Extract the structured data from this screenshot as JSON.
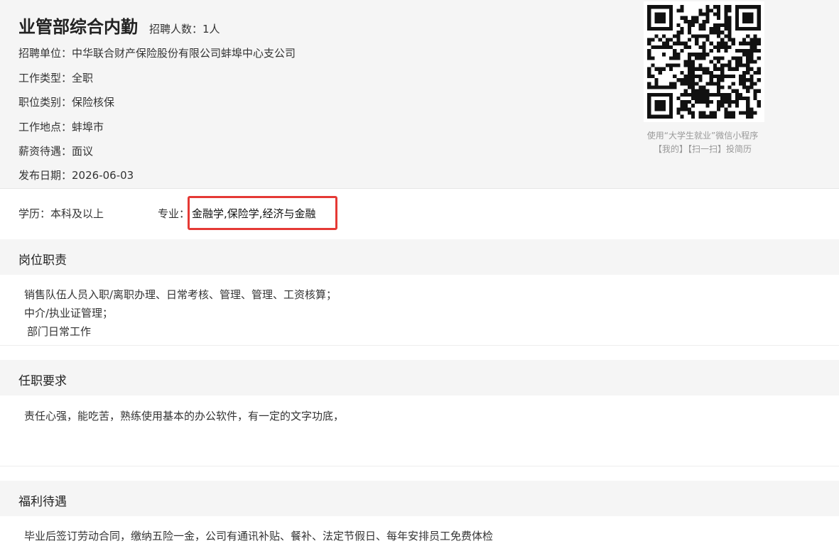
{
  "job": {
    "title": "业管部综合内勤",
    "headcount": "招聘人数：1人",
    "info": [
      {
        "label": "招聘单位：",
        "value": "中华联合财产保险股份有限公司蚌埠中心支公司"
      },
      {
        "label": "工作类型：",
        "value": "全职"
      },
      {
        "label": "职位类别：",
        "value": "保险核保"
      },
      {
        "label": "工作地点：",
        "value": "蚌埠市"
      },
      {
        "label": "薪资待遇：",
        "value": "面议"
      },
      {
        "label": "发布日期：",
        "value": "2026-06-03"
      }
    ]
  },
  "qr": {
    "caption_line1": "使用“大学生就业”微信小程序",
    "caption_line2": "【我的】【扫一扫】投简历"
  },
  "requirements": {
    "education": "学历：本科及以上",
    "major_label": "专业：",
    "major_value": "金融学,保险学,经济与金融"
  },
  "sections": {
    "duties": {
      "title": "岗位职责",
      "lines": [
        "销售队伍人员入职/离职办理、日常考核、管理、管理、工资核算；",
        "中介/执业证管理；",
        " 部门日常工作"
      ]
    },
    "qualifications": {
      "title": "任职要求",
      "lines": [
        "责任心强，能吃苦，熟练使用基本的办公软件，有一定的文字功底，"
      ]
    },
    "benefits": {
      "title": "福利待遇",
      "lines": [
        "毕业后签订劳动合同，缴纳五险一金，公司有通讯补贴、餐补、法定节假日、每年安排员工免费体检"
      ]
    }
  },
  "colors": {
    "highlight_border": "#e53935",
    "header_bg": "#f5f5f5"
  }
}
